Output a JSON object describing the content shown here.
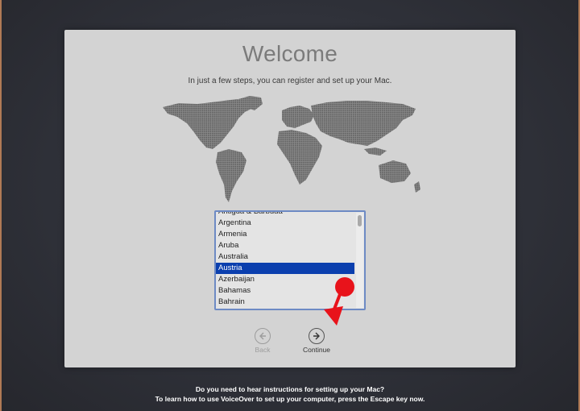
{
  "welcome": {
    "title": "Welcome",
    "subtitle": "In just a few steps, you can register and set up your Mac."
  },
  "country_list": {
    "items": [
      "Antigua & Barbuda",
      "Argentina",
      "Armenia",
      "Aruba",
      "Australia",
      "Austria",
      "Azerbaijan",
      "Bahamas",
      "Bahrain"
    ],
    "selected": "Austria"
  },
  "nav": {
    "back_label": "Back",
    "continue_label": "Continue"
  },
  "footer": {
    "line1": "Do you need to hear instructions for setting up your Mac?",
    "line2": "To learn how to use VoiceOver to set up your computer, press the Escape key now."
  },
  "colors": {
    "selection": "#0b3fae",
    "annotation_arrow": "#e8131b"
  },
  "icons": {
    "back": "back-arrow-circle-icon",
    "continue": "forward-arrow-circle-icon",
    "map": "world-map-image"
  }
}
